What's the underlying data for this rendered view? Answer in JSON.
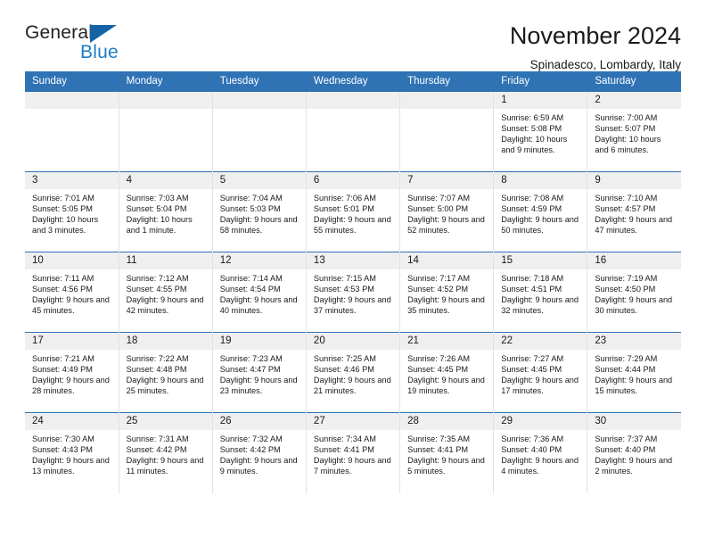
{
  "brand": {
    "word_one": "General",
    "word_two": "Blue",
    "triangle_color": "#1464a5",
    "blue_text_color": "#1d7cc4"
  },
  "header": {
    "title": "November 2024",
    "subtitle": "Spinadesco, Lombardy, Italy"
  },
  "theme": {
    "header_blue": "#2f73b5",
    "daynum_band": "#efefef",
    "cell_border": "#e2e2e2"
  },
  "weekday_headers": [
    "Sunday",
    "Monday",
    "Tuesday",
    "Wednesday",
    "Thursday",
    "Friday",
    "Saturday"
  ],
  "labels": {
    "sunrise_prefix": "Sunrise:",
    "sunset_prefix": "Sunset:",
    "daylight_prefix": "Daylight:"
  },
  "weeks": [
    [
      {
        "day": "",
        "sunrise": "",
        "sunset": "",
        "daylight": ""
      },
      {
        "day": "",
        "sunrise": "",
        "sunset": "",
        "daylight": ""
      },
      {
        "day": "",
        "sunrise": "",
        "sunset": "",
        "daylight": ""
      },
      {
        "day": "",
        "sunrise": "",
        "sunset": "",
        "daylight": ""
      },
      {
        "day": "",
        "sunrise": "",
        "sunset": "",
        "daylight": ""
      },
      {
        "day": "1",
        "sunrise": "Sunrise: 6:59 AM",
        "sunset": "Sunset: 5:08 PM",
        "daylight": "Daylight: 10 hours and 9 minutes."
      },
      {
        "day": "2",
        "sunrise": "Sunrise: 7:00 AM",
        "sunset": "Sunset: 5:07 PM",
        "daylight": "Daylight: 10 hours and 6 minutes."
      }
    ],
    [
      {
        "day": "3",
        "sunrise": "Sunrise: 7:01 AM",
        "sunset": "Sunset: 5:05 PM",
        "daylight": "Daylight: 10 hours and 3 minutes."
      },
      {
        "day": "4",
        "sunrise": "Sunrise: 7:03 AM",
        "sunset": "Sunset: 5:04 PM",
        "daylight": "Daylight: 10 hours and 1 minute."
      },
      {
        "day": "5",
        "sunrise": "Sunrise: 7:04 AM",
        "sunset": "Sunset: 5:03 PM",
        "daylight": "Daylight: 9 hours and 58 minutes."
      },
      {
        "day": "6",
        "sunrise": "Sunrise: 7:06 AM",
        "sunset": "Sunset: 5:01 PM",
        "daylight": "Daylight: 9 hours and 55 minutes."
      },
      {
        "day": "7",
        "sunrise": "Sunrise: 7:07 AM",
        "sunset": "Sunset: 5:00 PM",
        "daylight": "Daylight: 9 hours and 52 minutes."
      },
      {
        "day": "8",
        "sunrise": "Sunrise: 7:08 AM",
        "sunset": "Sunset: 4:59 PM",
        "daylight": "Daylight: 9 hours and 50 minutes."
      },
      {
        "day": "9",
        "sunrise": "Sunrise: 7:10 AM",
        "sunset": "Sunset: 4:57 PM",
        "daylight": "Daylight: 9 hours and 47 minutes."
      }
    ],
    [
      {
        "day": "10",
        "sunrise": "Sunrise: 7:11 AM",
        "sunset": "Sunset: 4:56 PM",
        "daylight": "Daylight: 9 hours and 45 minutes."
      },
      {
        "day": "11",
        "sunrise": "Sunrise: 7:12 AM",
        "sunset": "Sunset: 4:55 PM",
        "daylight": "Daylight: 9 hours and 42 minutes."
      },
      {
        "day": "12",
        "sunrise": "Sunrise: 7:14 AM",
        "sunset": "Sunset: 4:54 PM",
        "daylight": "Daylight: 9 hours and 40 minutes."
      },
      {
        "day": "13",
        "sunrise": "Sunrise: 7:15 AM",
        "sunset": "Sunset: 4:53 PM",
        "daylight": "Daylight: 9 hours and 37 minutes."
      },
      {
        "day": "14",
        "sunrise": "Sunrise: 7:17 AM",
        "sunset": "Sunset: 4:52 PM",
        "daylight": "Daylight: 9 hours and 35 minutes."
      },
      {
        "day": "15",
        "sunrise": "Sunrise: 7:18 AM",
        "sunset": "Sunset: 4:51 PM",
        "daylight": "Daylight: 9 hours and 32 minutes."
      },
      {
        "day": "16",
        "sunrise": "Sunrise: 7:19 AM",
        "sunset": "Sunset: 4:50 PM",
        "daylight": "Daylight: 9 hours and 30 minutes."
      }
    ],
    [
      {
        "day": "17",
        "sunrise": "Sunrise: 7:21 AM",
        "sunset": "Sunset: 4:49 PM",
        "daylight": "Daylight: 9 hours and 28 minutes."
      },
      {
        "day": "18",
        "sunrise": "Sunrise: 7:22 AM",
        "sunset": "Sunset: 4:48 PM",
        "daylight": "Daylight: 9 hours and 25 minutes."
      },
      {
        "day": "19",
        "sunrise": "Sunrise: 7:23 AM",
        "sunset": "Sunset: 4:47 PM",
        "daylight": "Daylight: 9 hours and 23 minutes."
      },
      {
        "day": "20",
        "sunrise": "Sunrise: 7:25 AM",
        "sunset": "Sunset: 4:46 PM",
        "daylight": "Daylight: 9 hours and 21 minutes."
      },
      {
        "day": "21",
        "sunrise": "Sunrise: 7:26 AM",
        "sunset": "Sunset: 4:45 PM",
        "daylight": "Daylight: 9 hours and 19 minutes."
      },
      {
        "day": "22",
        "sunrise": "Sunrise: 7:27 AM",
        "sunset": "Sunset: 4:45 PM",
        "daylight": "Daylight: 9 hours and 17 minutes."
      },
      {
        "day": "23",
        "sunrise": "Sunrise: 7:29 AM",
        "sunset": "Sunset: 4:44 PM",
        "daylight": "Daylight: 9 hours and 15 minutes."
      }
    ],
    [
      {
        "day": "24",
        "sunrise": "Sunrise: 7:30 AM",
        "sunset": "Sunset: 4:43 PM",
        "daylight": "Daylight: 9 hours and 13 minutes."
      },
      {
        "day": "25",
        "sunrise": "Sunrise: 7:31 AM",
        "sunset": "Sunset: 4:42 PM",
        "daylight": "Daylight: 9 hours and 11 minutes."
      },
      {
        "day": "26",
        "sunrise": "Sunrise: 7:32 AM",
        "sunset": "Sunset: 4:42 PM",
        "daylight": "Daylight: 9 hours and 9 minutes."
      },
      {
        "day": "27",
        "sunrise": "Sunrise: 7:34 AM",
        "sunset": "Sunset: 4:41 PM",
        "daylight": "Daylight: 9 hours and 7 minutes."
      },
      {
        "day": "28",
        "sunrise": "Sunrise: 7:35 AM",
        "sunset": "Sunset: 4:41 PM",
        "daylight": "Daylight: 9 hours and 5 minutes."
      },
      {
        "day": "29",
        "sunrise": "Sunrise: 7:36 AM",
        "sunset": "Sunset: 4:40 PM",
        "daylight": "Daylight: 9 hours and 4 minutes."
      },
      {
        "day": "30",
        "sunrise": "Sunrise: 7:37 AM",
        "sunset": "Sunset: 4:40 PM",
        "daylight": "Daylight: 9 hours and 2 minutes."
      }
    ]
  ]
}
